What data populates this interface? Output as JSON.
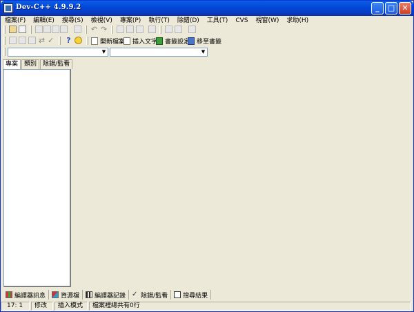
{
  "window": {
    "title": "Dev-C++ 4.9.9.2"
  },
  "titlebar_buttons": {
    "minimize": "_",
    "maximize": "□",
    "close": "✕"
  },
  "menu": [
    "檔案(F)",
    "編輯(E)",
    "搜尋(S)",
    "檢視(V)",
    "專案(P)",
    "執行(T)",
    "除錯(D)",
    "工具(T)",
    "CVS",
    "視窗(W)",
    "求助(H)"
  ],
  "toolbar": {
    "insert_text_label": "插入文字",
    "bookmark_set_label": "書籤設定",
    "goto_bookmark_label": "移至書籤",
    "new_file_label": "開新檔案",
    "help_glyph": "?"
  },
  "combo": {
    "class_value": "",
    "member_value": ""
  },
  "left_tabs": [
    "專案",
    "類別",
    "除錯/監看"
  ],
  "bottom_tabs": [
    "編譯器訊息",
    "資源檔",
    "編譯器記錄",
    "除錯/監看",
    "搜尋結果"
  ],
  "status": {
    "position": "17: 1",
    "modified": "修改",
    "mode": "插入模式",
    "lines": "檔案裡總共有0行"
  }
}
